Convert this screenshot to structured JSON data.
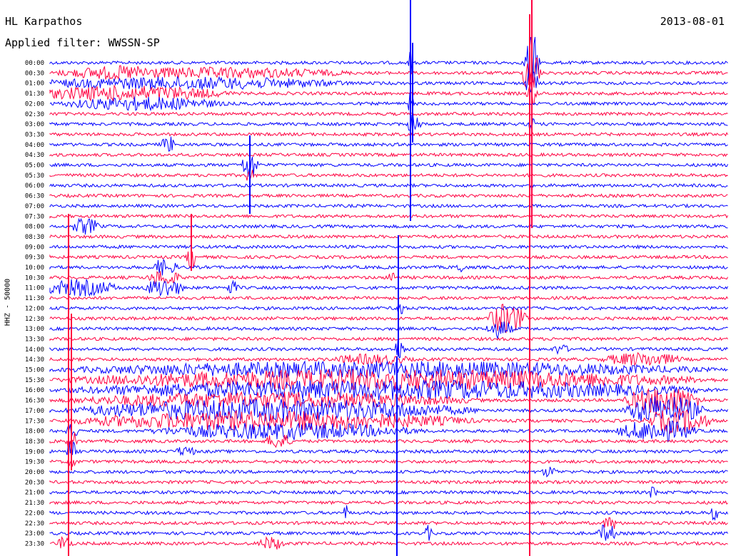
{
  "header": {
    "station": "HL Karpathos",
    "date": "2013-08-01",
    "filter": "Applied filter: WWSSN-SP"
  },
  "chart_data": {
    "type": "line",
    "ylabel": "HHZ - 50000",
    "tick_labels": [
      "00:00",
      "00:30",
      "01:00",
      "01:30",
      "02:00",
      "02:30",
      "03:00",
      "03:30",
      "04:00",
      "04:30",
      "05:00",
      "05:30",
      "06:00",
      "06:30",
      "07:00",
      "07:30",
      "08:00",
      "08:30",
      "09:00",
      "09:30",
      "10:00",
      "10:30",
      "11:00",
      "11:30",
      "12:00",
      "12:30",
      "13:00",
      "13:30",
      "14:00",
      "14:30",
      "15:00",
      "15:30",
      "16:00",
      "16:30",
      "17:00",
      "17:30",
      "18:00",
      "18:30",
      "19:00",
      "19:30",
      "20:00",
      "20:30",
      "21:00",
      "21:30",
      "22:00",
      "22:30",
      "23:00",
      "23:30"
    ],
    "colors": [
      "#0000ff",
      "#ff0040"
    ],
    "grid": false
  }
}
